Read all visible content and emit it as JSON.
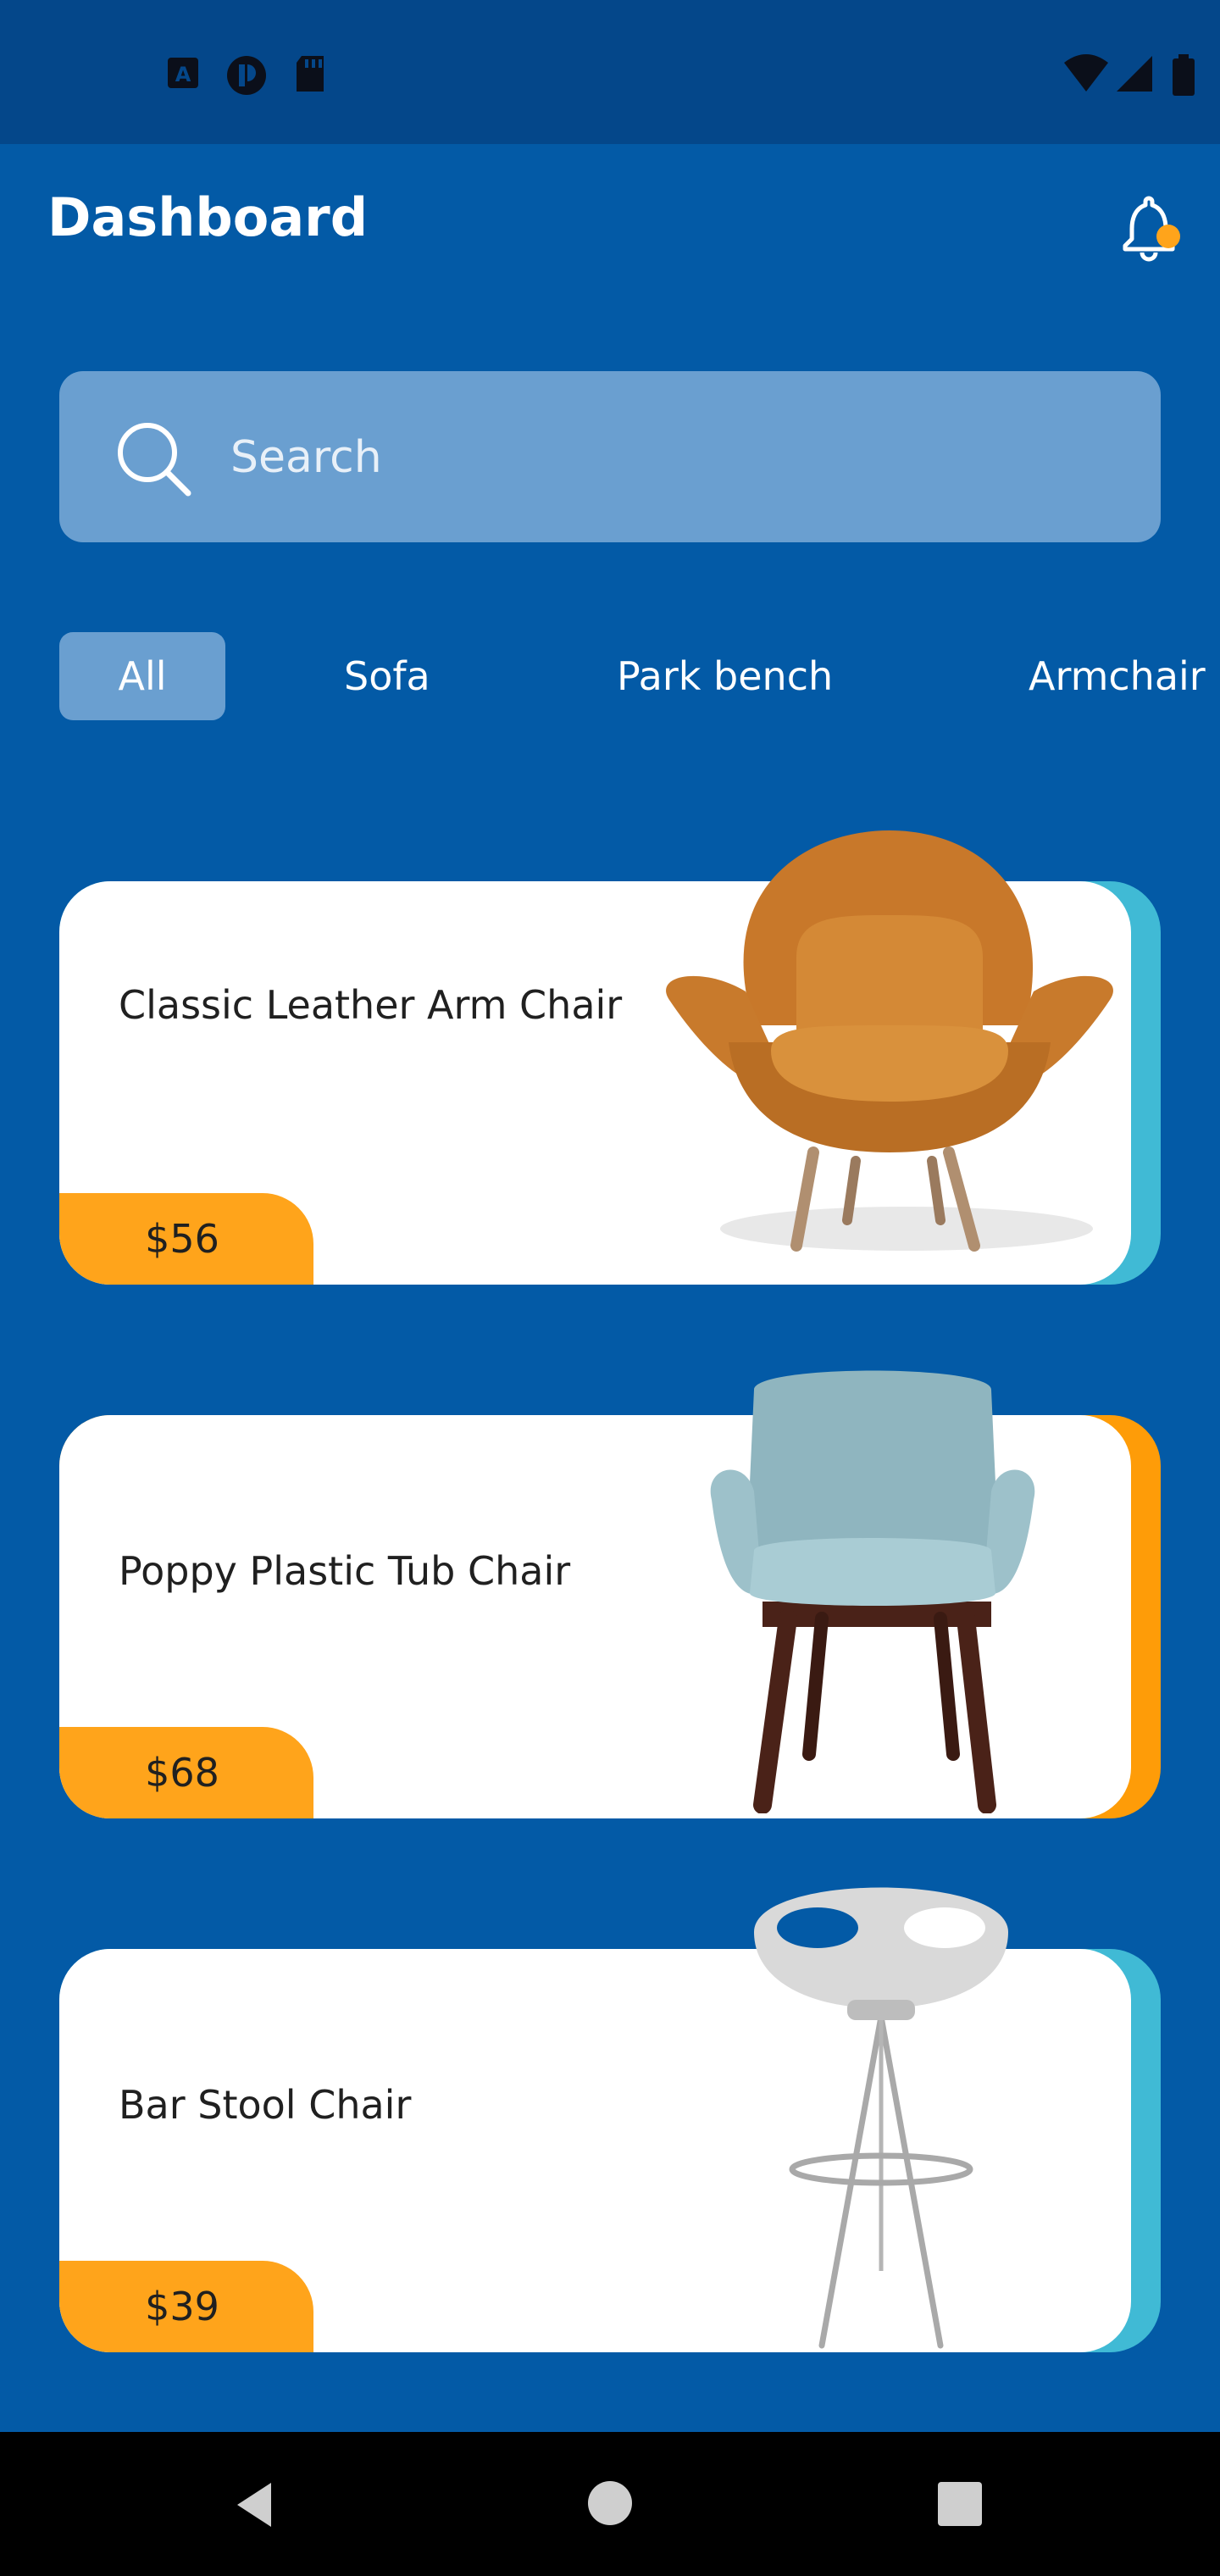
{
  "header": {
    "title": "Dashboard"
  },
  "search": {
    "placeholder": "Search"
  },
  "categories": [
    {
      "label": "All",
      "active": true
    },
    {
      "label": "Sofa",
      "active": false
    },
    {
      "label": "Park bench",
      "active": false
    },
    {
      "label": "Armchair",
      "active": false
    }
  ],
  "products": [
    {
      "name": "Classic Leather Arm Chair",
      "price": "$56",
      "accent_color": "#40bad5",
      "image": "armchair-image"
    },
    {
      "name": "Poppy Plastic Tub Chair",
      "price": "$68",
      "accent_color": "#fe9c08",
      "image": "tub-chair-image"
    },
    {
      "name": "Bar Stool Chair",
      "price": "$39",
      "accent_color": "#40bad5",
      "image": "bar-stool-image"
    }
  ],
  "colors": {
    "background": "#035aa6",
    "status_bar": "#04478a",
    "search_bg": "#6a9fd0",
    "price_tag": "#ffa41b",
    "notification_dot": "#ffa41b"
  },
  "icons": {
    "status_left": [
      "a-notification-icon",
      "app-notification-icon",
      "sd-card-icon"
    ],
    "status_right": [
      "wifi-icon",
      "signal-icon",
      "battery-icon"
    ],
    "navigation": [
      "back-icon",
      "home-icon",
      "recents-icon"
    ]
  }
}
